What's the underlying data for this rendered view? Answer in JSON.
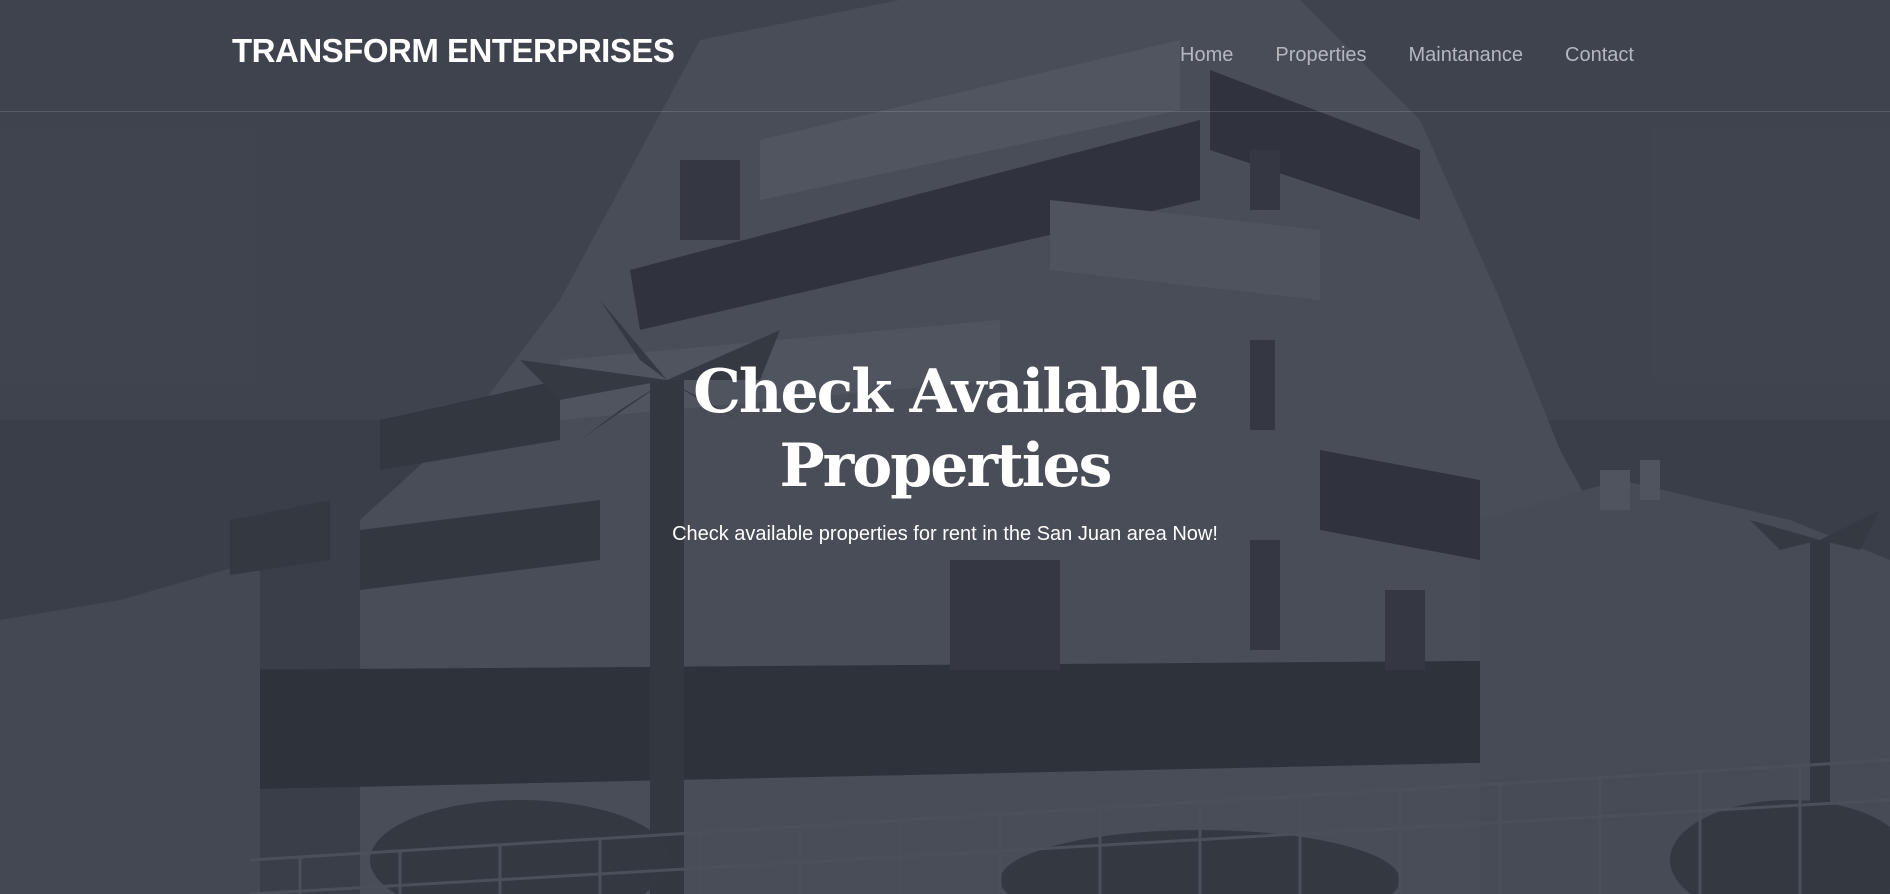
{
  "brand": {
    "name": "TRANSFORM ENTERPRISES"
  },
  "nav": {
    "items": [
      {
        "label": "Home"
      },
      {
        "label": "Properties"
      },
      {
        "label": "Maintanance"
      },
      {
        "label": "Contact"
      }
    ]
  },
  "hero": {
    "title_line1": "Check Available",
    "title_line2": "Properties",
    "subtitle": "Check available properties for rent in the San Juan area Now!"
  },
  "colors": {
    "overlay": "#2d323c",
    "text": "#ffffff",
    "nav_link": "#b4b8be"
  }
}
